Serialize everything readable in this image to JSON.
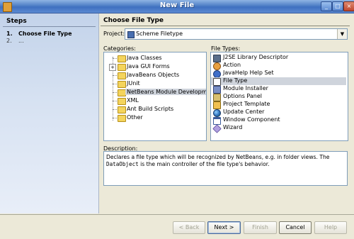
{
  "window": {
    "title": "New File"
  },
  "steps": {
    "title": "Steps",
    "items": [
      {
        "num": "1.",
        "label": "Choose File Type"
      },
      {
        "num": "2.",
        "label": "..."
      }
    ]
  },
  "panel": {
    "title": "Choose File Type"
  },
  "project": {
    "label": "Project:",
    "value": "Scheme Filetype"
  },
  "categories": {
    "label": "Categories:",
    "items": [
      {
        "label": "Java Classes"
      },
      {
        "label": "Java GUI Forms"
      },
      {
        "label": "JavaBeans Objects"
      },
      {
        "label": "JUnit"
      },
      {
        "label": "NetBeans Module Development"
      },
      {
        "label": "XML"
      },
      {
        "label": "Ant Build Scripts"
      },
      {
        "label": "Other"
      }
    ],
    "selected": "NetBeans Module Development"
  },
  "file_types": {
    "label": "File Types:",
    "items": [
      {
        "label": "J2SE Library Descriptor",
        "icon": "library-icon"
      },
      {
        "label": "Action",
        "icon": "action-icon"
      },
      {
        "label": "JavaHelp Help Set",
        "icon": "help-set-icon"
      },
      {
        "label": "File Type",
        "icon": "file-type-icon"
      },
      {
        "label": "Module Installer",
        "icon": "module-installer-icon"
      },
      {
        "label": "Options Panel",
        "icon": "options-panel-icon"
      },
      {
        "label": "Project Template",
        "icon": "project-template-icon"
      },
      {
        "label": "Update Center",
        "icon": "globe-icon"
      },
      {
        "label": "Window Component",
        "icon": "window-component-icon"
      },
      {
        "label": "Wizard",
        "icon": "wizard-icon"
      }
    ],
    "selected": "File Type"
  },
  "description": {
    "label": "Description:",
    "text_before": "Declares a file type which will be recognized by NetBeans, e.g. in folder views. The ",
    "code": "DataObject",
    "text_after": " is the main controller of the file type's behavior."
  },
  "buttons": {
    "back": "< Back",
    "next": "Next >",
    "finish": "Finish",
    "cancel": "Cancel",
    "help": "Help"
  },
  "colors": {
    "selection": "#cfd4dc",
    "titlebar": "#4f7fc6",
    "steps_bg": "#c3d3ea"
  }
}
